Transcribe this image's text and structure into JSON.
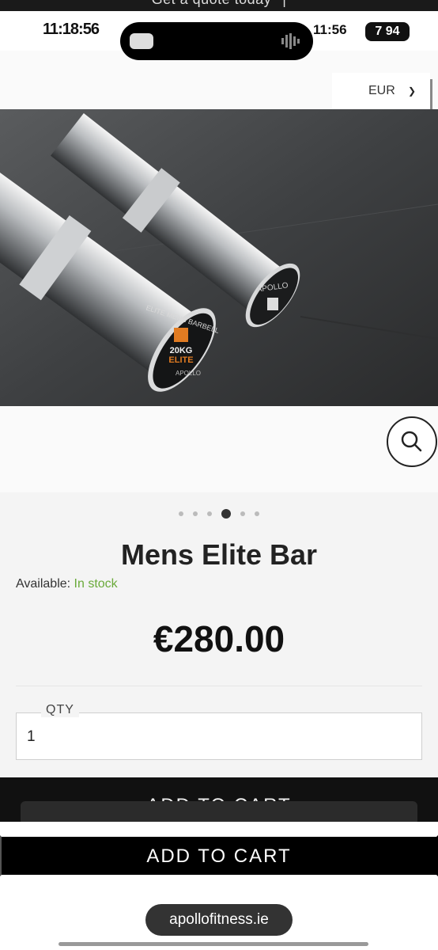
{
  "promo": {
    "text": "Get a quote today",
    "separator": "|"
  },
  "status_bar": {
    "time": "11:18:56",
    "right_text": "11:56",
    "battery": "7 94"
  },
  "currency": {
    "value": "EUR"
  },
  "product": {
    "title": "Mens Elite Bar",
    "availability_label": "Available:",
    "availability_value": "In stock",
    "price": "€280.00",
    "image_text": {
      "bar_line1": "ELITE MENS BARBELL",
      "bar_weight": "20KG",
      "bar_grade": "ELITE",
      "bar_brand": "APOLLO",
      "bar2_brand": "APOLLO"
    }
  },
  "gallery": {
    "dot_count": 6,
    "active_index": 3
  },
  "quantity": {
    "label": "QTY",
    "value": "1"
  },
  "cart": {
    "back_label": "ADD TO CART",
    "button_label": "ADD TO CART"
  },
  "browser": {
    "url": "apollofitness.ie"
  },
  "colors": {
    "in_stock": "#6aaa3a",
    "button_bg": "#000000"
  },
  "icons": {
    "zoom": "magnifier-icon",
    "currency_chevron": "chevron-down-icon"
  }
}
